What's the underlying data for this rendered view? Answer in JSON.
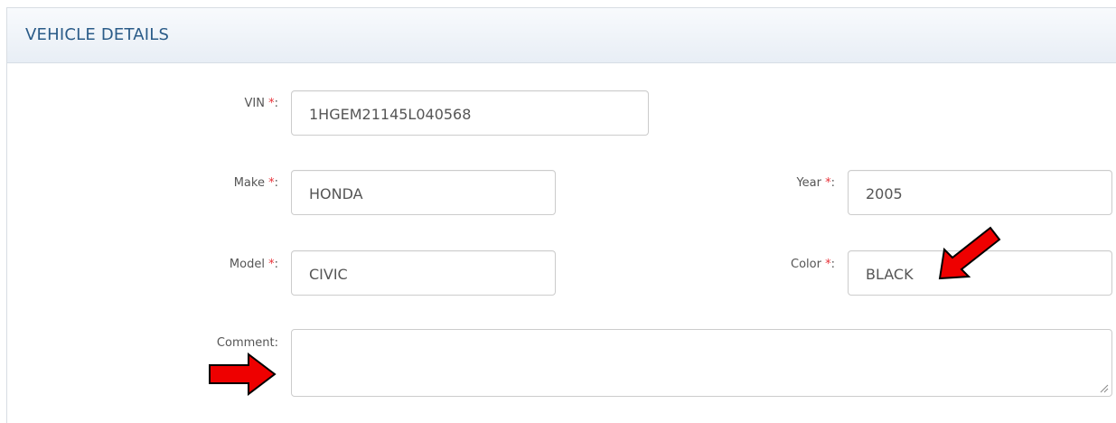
{
  "section": {
    "title": "VEHICLE DETAILS"
  },
  "fields": {
    "vin": {
      "label": "VIN",
      "required_mark": "*",
      "colon": ":",
      "value": "1HGEM21145L040568"
    },
    "make": {
      "label": "Make",
      "required_mark": "*",
      "colon": ":",
      "value": "HONDA"
    },
    "year": {
      "label": "Year",
      "required_mark": "*",
      "colon": ":",
      "value": "2005"
    },
    "model": {
      "label": "Model",
      "required_mark": "*",
      "colon": ":",
      "value": "CIVIC"
    },
    "color": {
      "label": "Color",
      "required_mark": "*",
      "colon": ":",
      "value": "BLACK"
    },
    "comment": {
      "label": "Comment:",
      "value": ""
    }
  },
  "annotations": {
    "arrow_color": "#ee0000",
    "arrow_outline": "#000000",
    "items": [
      "color-pointer-arrow-icon",
      "comment-pointer-arrow-icon"
    ]
  },
  "colors": {
    "header_text": "#2a5b88",
    "required_star": "#e8333a",
    "label_text": "#555555"
  }
}
